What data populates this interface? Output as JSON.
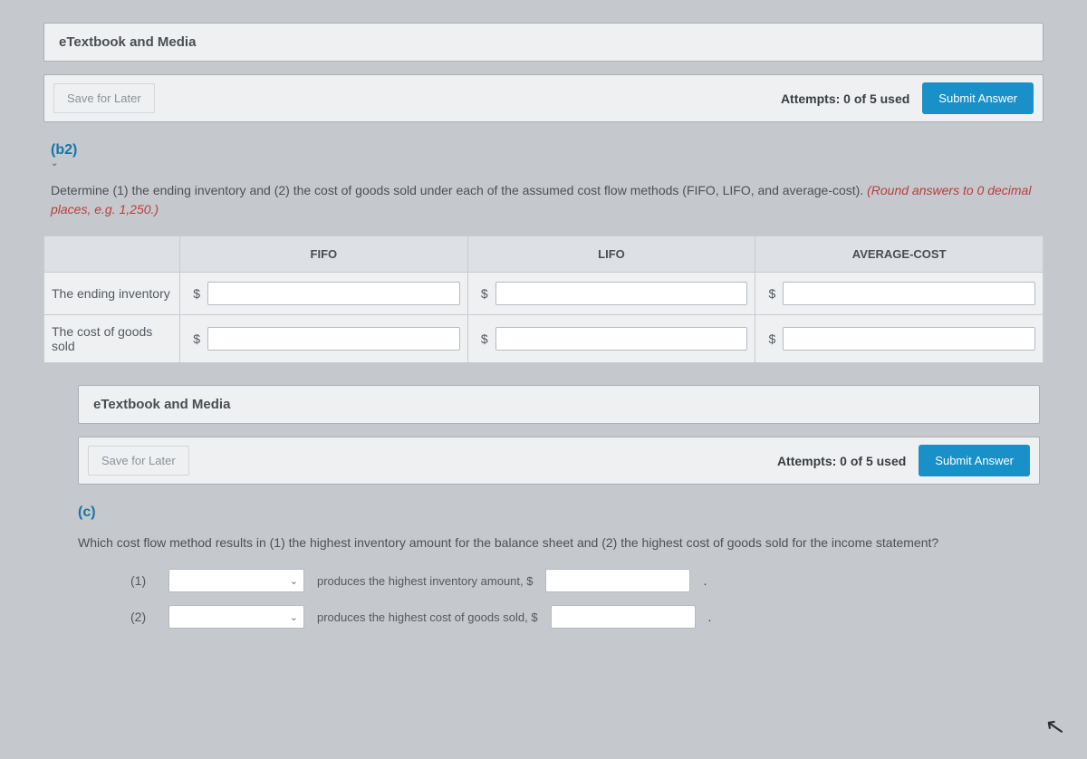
{
  "top": {
    "etextbook_label": "eTextbook and Media",
    "save_label": "Save for Later",
    "attempts_text": "Attempts: 0 of 5 used",
    "submit_label": "Submit Answer"
  },
  "b2": {
    "tag": "(b2)",
    "instruction_main": "Determine (1) the ending inventory and (2) the cost of goods sold under each of the assumed cost flow methods (FIFO, LIFO, and average-cost). ",
    "instruction_round": "(Round answers to 0 decimal places, e.g. 1,250.)",
    "headers": {
      "c1": "FIFO",
      "c2": "LIFO",
      "c3": "AVERAGE-COST"
    },
    "rows": {
      "r1": "The ending inventory",
      "r2": "The cost of goods sold"
    },
    "currency": "$",
    "inner": {
      "etextbook_label": "eTextbook and Media",
      "save_label": "Save for Later",
      "attempts_text": "Attempts: 0 of 5 used",
      "submit_label": "Submit Answer"
    }
  },
  "c": {
    "tag": "(c)",
    "question": "Which cost flow method results in (1) the highest inventory amount for the balance sheet and (2) the highest cost of goods sold for the income statement?",
    "items": {
      "n1": "(1)",
      "n2": "(2)",
      "t1": "produces the highest inventory amount, $",
      "t2": "produces the highest cost of goods sold, $"
    }
  }
}
